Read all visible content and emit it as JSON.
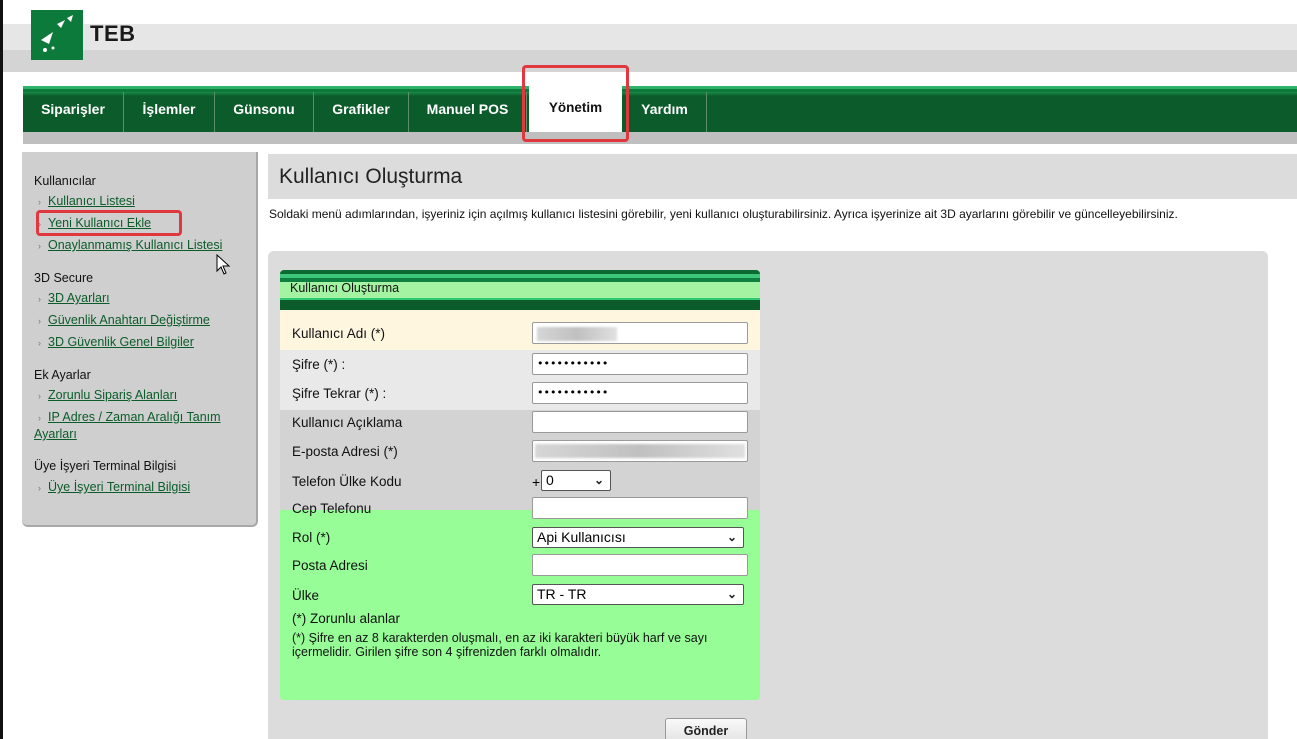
{
  "brand": {
    "name": "TEB"
  },
  "nav": {
    "items": [
      {
        "label": "Siparişler"
      },
      {
        "label": "İşlemler"
      },
      {
        "label": "Günsonu"
      },
      {
        "label": "Grafikler"
      },
      {
        "label": "Manuel POS"
      },
      {
        "label": "Yönetim",
        "active": true
      },
      {
        "label": "Yardım"
      }
    ]
  },
  "sidebar": {
    "sections": [
      {
        "title": "Kullanıcılar",
        "links": [
          "Kullanıcı Listesi",
          "Yeni Kullanıcı Ekle",
          "Onaylanmamış Kullanıcı Listesi"
        ]
      },
      {
        "title": "3D Secure",
        "links": [
          "3D Ayarları",
          "Güvenlik Anahtarı Değiştirme",
          "3D Güvenlik Genel Bilgiler"
        ]
      },
      {
        "title": "Ek Ayarlar",
        "links": [
          "Zorunlu Sipariş Alanları",
          "IP Adres / Zaman Aralığı Tanım",
          "Ayarları"
        ]
      },
      {
        "title": "Üye İşyeri Terminal Bilgisi",
        "links": [
          "Üye İşyeri Terminal Bilgisi"
        ]
      }
    ]
  },
  "main": {
    "title": "Kullanıcı Oluşturma",
    "description": "Soldaki menü adımlarından, işyeriniz için açılmış kullanıcı listesini görebilir, yeni kullanıcı oluşturabilirsiniz. Ayrıca işyerinize ait 3D ayarlarını görebilir ve güncelleyebilirsiniz."
  },
  "form": {
    "header": "Kullanıcı Oluşturma",
    "fields": {
      "username": {
        "label": "Kullanıcı Adı (*)"
      },
      "password": {
        "label": "Şifre (*) :",
        "value": "•••••••••••"
      },
      "password_repeat": {
        "label": "Şifre Tekrar (*) :",
        "value": "•••••••••••"
      },
      "description": {
        "label": "Kullanıcı Açıklama",
        "value": ""
      },
      "email": {
        "label": "E-posta Adresi (*)"
      },
      "phone_country": {
        "label": "Telefon Ülke Kodu",
        "prefix": "+",
        "value": "0"
      },
      "mobile": {
        "label": "Cep Telefonu",
        "value": ""
      },
      "role": {
        "label": "Rol (*)",
        "value": "Api Kullanıcısı"
      },
      "address": {
        "label": "Posta Adresi",
        "value": ""
      },
      "country": {
        "label": "Ülke",
        "value": "TR - TR"
      }
    },
    "note_required": "(*) Zorunlu alanlar",
    "note_password": "(*) Şifre en az 8 karakterden oluşmalı, en az iki karakteri büyük harf ve sayı içermelidir. Girilen şifre son 4 şifrenizden farklı olmalıdır.",
    "submit_label": "Gönder"
  },
  "colors": {
    "brand_green": "#0b5c2a",
    "form_green": "#97fe97",
    "highlight_red": "#e0383e"
  }
}
